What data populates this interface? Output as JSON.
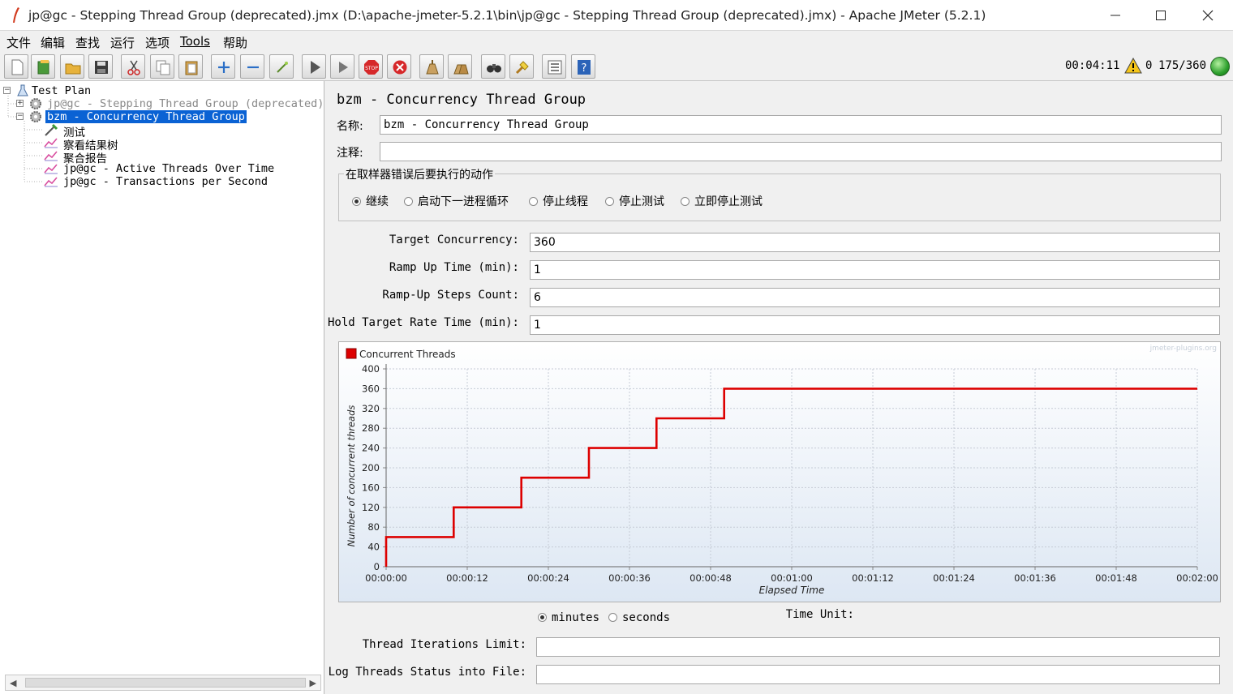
{
  "window": {
    "title": "jp@gc - Stepping Thread Group (deprecated).jmx (D:\\apache-jmeter-5.2.1\\bin\\jp@gc - Stepping Thread Group (deprecated).jmx) - Apache JMeter (5.2.1)"
  },
  "menu": [
    "文件",
    "编辑",
    "查找",
    "运行",
    "选项",
    "Tools",
    "帮助"
  ],
  "toolbar": {
    "buttons": [
      "new",
      "templates",
      "open",
      "save",
      "cut",
      "copy",
      "paste",
      "expand",
      "collapse",
      "toggle",
      "start",
      "start-no-pauses",
      "stop",
      "shutdown",
      "clear",
      "clear-all",
      "search",
      "reset-search",
      "function-helper",
      "help"
    ],
    "elapsed": "00:04:11",
    "warnings": "0",
    "threads": "175/360"
  },
  "tree": {
    "items": [
      {
        "label": "Test Plan"
      },
      {
        "label": "jp@gc - Stepping Thread Group (deprecated)"
      },
      {
        "label": "bzm - Concurrency Thread Group"
      },
      {
        "label": "测试"
      },
      {
        "label": "察看结果树"
      },
      {
        "label": "聚合报告"
      },
      {
        "label": "jp@gc - Active Threads Over Time"
      },
      {
        "label": "jp@gc - Transactions per Second"
      }
    ]
  },
  "panel": {
    "title": "bzm - Concurrency Thread Group",
    "name_label": "名称:",
    "name_value": "bzm - Concurrency Thread Group",
    "comment_label": "注释:",
    "comment_value": "",
    "error_group_title": "在取样器错误后要执行的动作",
    "error_actions": [
      "继续",
      "启动下一进程循环",
      "停止线程",
      "停止测试",
      "立即停止测试"
    ],
    "error_selected": "继续",
    "target_concurrency_label": "Target Concurrency:",
    "target_concurrency": "360",
    "ramp_up_label": "Ramp Up Time (min):",
    "ramp_up": "1",
    "steps_label": "Ramp-Up Steps Count:",
    "steps": "6",
    "hold_label": "Hold Target Rate Time (min):",
    "hold": "1",
    "time_unit_label": "Time Unit:",
    "time_units": [
      "minutes",
      "seconds"
    ],
    "time_unit_selected": "minutes",
    "iterations_label": "Thread Iterations Limit:",
    "iterations": "",
    "log_label": "Log Threads Status into File:",
    "log_file": ""
  },
  "chart_data": {
    "type": "line",
    "watermark": "jmeter-plugins.org",
    "xlabel": "Elapsed Time",
    "ylabel": "Number of concurrent threads",
    "ylim": [
      0,
      400
    ],
    "yticks": [
      0,
      40,
      80,
      120,
      160,
      200,
      240,
      280,
      320,
      360,
      400
    ],
    "xlim_seconds": [
      0,
      120
    ],
    "xticks": [
      "00:00:00",
      "00:00:12",
      "00:00:24",
      "00:00:36",
      "00:00:48",
      "00:01:00",
      "00:01:12",
      "00:01:24",
      "00:01:36",
      "00:01:48",
      "00:02:00"
    ],
    "grid": true,
    "legend_position": "top-left",
    "series": [
      {
        "name": "Concurrent Threads",
        "color": "#dd0000",
        "x_seconds": [
          0,
          0,
          10,
          10,
          20,
          20,
          30,
          30,
          40,
          40,
          50,
          50,
          120
        ],
        "values": [
          0,
          60,
          60,
          120,
          120,
          180,
          180,
          240,
          240,
          300,
          300,
          360,
          360
        ]
      }
    ]
  }
}
